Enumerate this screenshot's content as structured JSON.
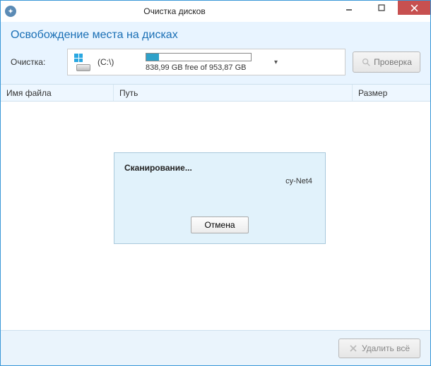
{
  "window": {
    "title": "Очистка дисков"
  },
  "header": {
    "subtitle": "Освобождение места на дисках",
    "cleanup_label": "Очистка:",
    "drive_name": "(C:\\)",
    "usage_text": "838,99 GB free of 953,87 GB",
    "check_button": "Проверка"
  },
  "columns": {
    "name": "Имя файла",
    "path": "Путь",
    "size": "Размер"
  },
  "scan": {
    "title": "Сканирование...",
    "current": "cy-Net4",
    "cancel": "Отмена"
  },
  "footer": {
    "delete_all": "Удалить всё"
  }
}
